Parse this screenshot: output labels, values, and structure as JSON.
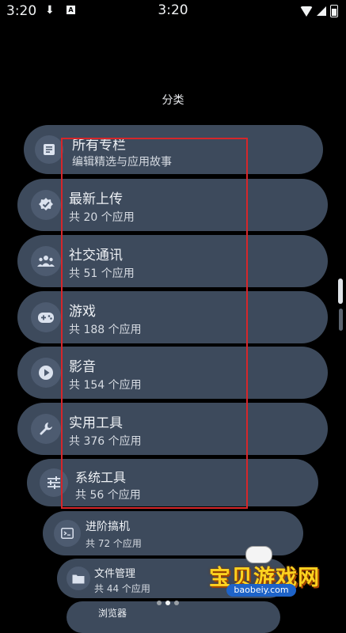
{
  "status_bar": {
    "time_left": "3:20",
    "time_center": "3:20",
    "a_badge": "A"
  },
  "header": {
    "title": "分类"
  },
  "categories": [
    {
      "title": "所有专栏",
      "subtitle": "编辑精选与应用故事",
      "icon": "article-icon"
    },
    {
      "title": "最新上传",
      "subtitle": "共 20 个应用",
      "icon": "new-releases-icon"
    },
    {
      "title": "社交通讯",
      "subtitle": "共 51 个应用",
      "icon": "people-icon"
    },
    {
      "title": "游戏",
      "subtitle": "共 188 个应用",
      "icon": "gamepad-icon"
    },
    {
      "title": "影音",
      "subtitle": "共 154 个应用",
      "icon": "play-icon"
    },
    {
      "title": "实用工具",
      "subtitle": "共 376 个应用",
      "icon": "wrench-icon"
    },
    {
      "title": "系统工具",
      "subtitle": "共 56 个应用",
      "icon": "tune-icon"
    },
    {
      "title": "进阶搞机",
      "subtitle": "共 72 个应用",
      "icon": "terminal-icon"
    },
    {
      "title": "文件管理",
      "subtitle": "共 44 个应用",
      "icon": "folder-icon"
    },
    {
      "title": "浏览器",
      "subtitle": "",
      "icon": "browser-icon"
    }
  ],
  "watermark": {
    "text": "宝贝游戏网",
    "url": "baobeiy.com"
  },
  "colors": {
    "pill": "#3d4a5c",
    "icon_bg": "#4d5b70",
    "selection": "#d6262a"
  }
}
